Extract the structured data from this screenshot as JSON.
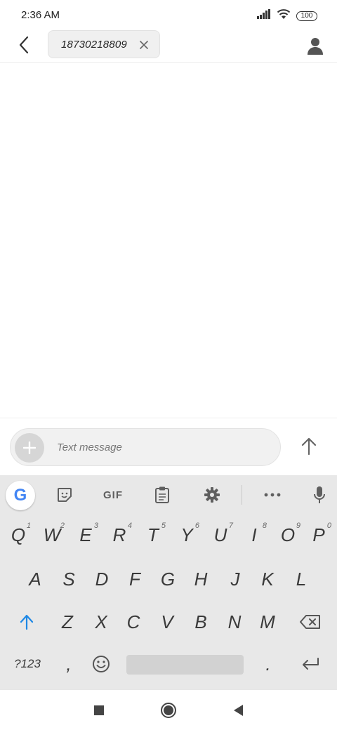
{
  "status_bar": {
    "time": "2:36 AM",
    "battery": "100"
  },
  "header": {
    "recipient": "18730218809"
  },
  "compose": {
    "placeholder": "Text message"
  },
  "keyboard": {
    "toolbar": {
      "gif_label": "GIF"
    },
    "row1": [
      {
        "label": "Q",
        "hint": "1"
      },
      {
        "label": "W",
        "hint": "2"
      },
      {
        "label": "E",
        "hint": "3"
      },
      {
        "label": "R",
        "hint": "4"
      },
      {
        "label": "T",
        "hint": "5"
      },
      {
        "label": "Y",
        "hint": "6"
      },
      {
        "label": "U",
        "hint": "7"
      },
      {
        "label": "I",
        "hint": "8"
      },
      {
        "label": "O",
        "hint": "9"
      },
      {
        "label": "P",
        "hint": "0"
      }
    ],
    "row2": [
      "A",
      "S",
      "D",
      "F",
      "G",
      "H",
      "J",
      "K",
      "L"
    ],
    "row3": [
      "Z",
      "X",
      "C",
      "V",
      "B",
      "N",
      "M"
    ],
    "row4": {
      "symbols": "?123",
      "comma": ",",
      "period": "."
    }
  }
}
